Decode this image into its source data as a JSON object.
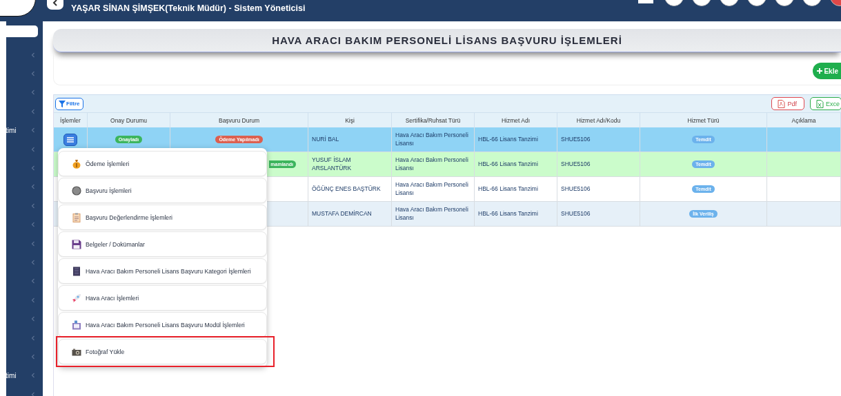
{
  "header": {
    "user": "YAŞAR SİNAN ŞİMŞEK(Teknik Müdür) - Sistem Yöneticisi"
  },
  "sidebar": {
    "labels": [
      "timi",
      "timi"
    ]
  },
  "page_title": "HAVA ARACI BAKIM PERSONELİ LİSANS BAŞVURU İŞLEMLERİ",
  "add_button": "Ekle",
  "toolbar": {
    "filter": "Filtre",
    "pdf": "Pdf",
    "excel": "Exce"
  },
  "table": {
    "columns": [
      "İşlemler",
      "Onay Durumu",
      "Başvuru Durum",
      "Kişi",
      "Sertifika/Ruhsat Türü",
      "Hizmet Adı",
      "Hizmet Adı/Kodu",
      "Hizmet Türü",
      "Açıklama"
    ],
    "rows": [
      {
        "kind": "selected",
        "actions": true,
        "approval": {
          "text": "Onayladı",
          "color": "#3cb55d"
        },
        "status": {
          "text": "Ödeme Yapılmadı",
          "color": "#dc5f4f",
          "cut": false
        },
        "person": "NURİ BAL",
        "certificate": "Hava Aracı Bakım Personeli Lisansı",
        "service": "HBL-66 Lisans Tanzimi",
        "code": "SHUE5106",
        "type": {
          "text": "Temdit",
          "color": "#6cb2ec"
        }
      },
      {
        "kind": "success",
        "status": {
          "text": "mamlandı",
          "color": "#3cb55d",
          "cut": true
        },
        "person": "YUSUF İSLAM ARSLANTÜRK",
        "certificate": "Hava Aracı Bakım Personeli Lisansı",
        "service": "HBL-66 Lisans Tanzimi",
        "code": "SHUE5106",
        "type": {
          "text": "Temdit",
          "color": "#6cb2ec"
        }
      },
      {
        "kind": "plain",
        "person": "ÖĞÜNÇ ENES BAŞTÜRK",
        "certificate": "Hava Aracı Bakım Personeli Lisansı",
        "service": "HBL-66 Lisans Tanzimi",
        "code": "SHUE5106",
        "type": {
          "text": "Temdit",
          "color": "#6cb2ec"
        }
      },
      {
        "kind": "alt",
        "person": "MUSTAFA DEMİRCAN",
        "certificate": "Hava Aracı Bakım Personeli Lisansı",
        "service": "HBL-66 Lisans Tanzimi",
        "code": "SHUE5106",
        "type": {
          "text": "İlk Veriliş",
          "color": "#6cb2ec"
        }
      }
    ]
  },
  "menu": {
    "items": [
      {
        "label": "Ödeme İşlemleri",
        "highlighted": false
      },
      {
        "label": "Başvuru İşlemleri",
        "highlighted": false
      },
      {
        "label": "Başvuru Değerlendirme İşlemleri",
        "highlighted": false
      },
      {
        "label": "Belgeler / Dokümanlar",
        "highlighted": false
      },
      {
        "label": "Hava Aracı Bakım Personeli Lisans Başvuru Kategori İşlemleri",
        "highlighted": false
      },
      {
        "label": "Hava Aracı İşlemleri",
        "highlighted": false
      },
      {
        "label": "Hava Aracı Bakım Personeli Lisans Başvuru Modül İşlemleri",
        "highlighted": false
      },
      {
        "label": "Fotoğraf Yükle",
        "highlighted": true
      }
    ]
  }
}
